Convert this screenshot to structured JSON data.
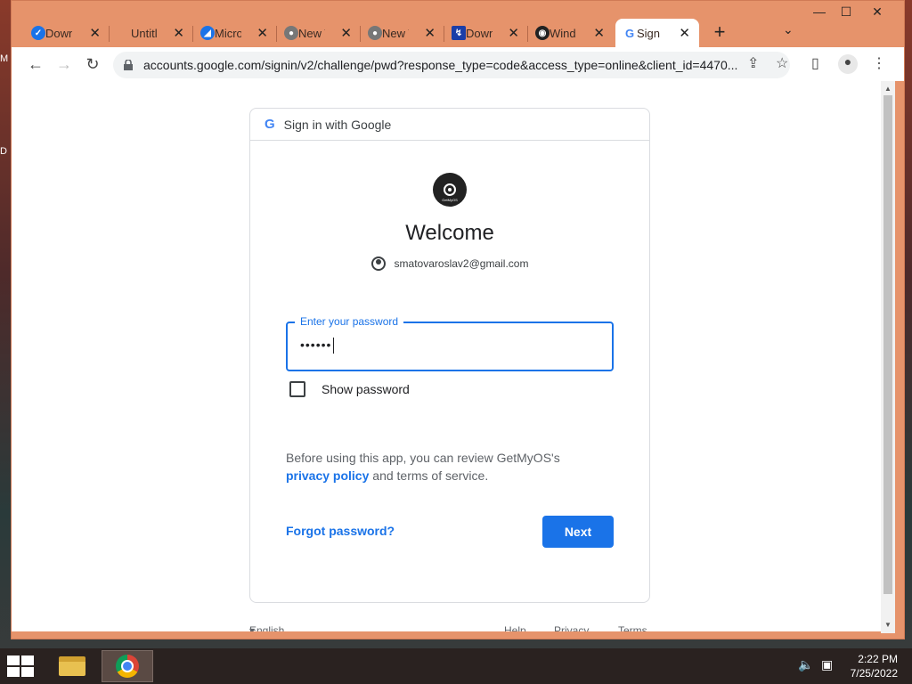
{
  "desktop": {
    "edge_letters": [
      "M",
      "D"
    ]
  },
  "window": {
    "controls": {
      "minimize": "—",
      "maximize": "☐",
      "close": "✕"
    },
    "tabs": [
      {
        "label": "Down",
        "icon": "check-icon",
        "color": "#1a73e8"
      },
      {
        "label": "Untitl",
        "icon": "blank-icon",
        "color": ""
      },
      {
        "label": "Micro",
        "icon": "microsoft-icon",
        "color": "#1a73e8"
      },
      {
        "label": "New T",
        "icon": "chrome-icon",
        "color": "#666666"
      },
      {
        "label": "New T",
        "icon": "chrome-icon",
        "color": "#666666"
      },
      {
        "label": "Down",
        "icon": "download-icon",
        "color": "#1a3ea8"
      },
      {
        "label": "Wind",
        "icon": "disc-icon",
        "color": "#222222"
      },
      {
        "label": "Sign i",
        "icon": "google-icon",
        "color": "#4285f4",
        "active": true
      }
    ],
    "new_tab": "+",
    "tab_menu": "⌄"
  },
  "toolbar": {
    "url": "accounts.google.com/signin/v2/challenge/pwd?response_type=code&access_type=online&client_id=4470..."
  },
  "signin": {
    "header": "Sign in with Google",
    "header_logo": "G",
    "app_logo_text": "GetMyOS",
    "welcome": "Welcome",
    "email": "smatovaroslav2@gmail.com",
    "password_label": "Enter your password",
    "password_value": "••••••",
    "show_password": "Show password",
    "notice_prefix": "Before using this app, you can review GetMyOS's",
    "privacy_link": "privacy policy",
    "notice_suffix": "and terms of service.",
    "forgot": "Forgot password?",
    "next": "Next"
  },
  "footer": {
    "language": "English (United States)",
    "help": "Help",
    "privacy": "Privacy",
    "terms": "Terms"
  },
  "taskbar": {
    "time": "2:22 PM",
    "date": "7/25/2022"
  }
}
